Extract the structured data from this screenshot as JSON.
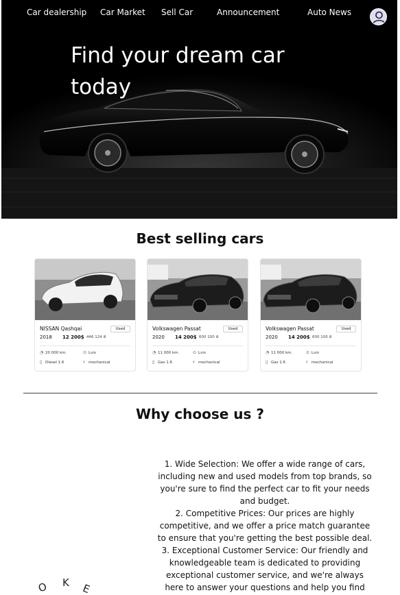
{
  "nav": {
    "items": [
      "Car dealership",
      "Car Market",
      "Sell Car",
      "Announcement",
      "Auto News"
    ]
  },
  "hero": {
    "title": "Find your dream car today"
  },
  "best": {
    "title": "Best selling cars",
    "cards": [
      {
        "name": "NISSAN Qashqai",
        "badge": "Used",
        "year": "2018",
        "price": "12 200$",
        "uah": "446 124 ₴",
        "km": "20 000 km.",
        "city": "Lviv",
        "fuel": "Diesel 1.6",
        "gearbox": "mechanical",
        "color": "#f2f2f2"
      },
      {
        "name": "Volkswagen Passat",
        "badge": "Used",
        "year": "2020",
        "price": "14 200$",
        "uah": "600 100 ₴",
        "km": "11 000 km.",
        "city": "Lviv",
        "fuel": "Gas 1.6",
        "gearbox": "mechanical",
        "color": "#1c1c1c"
      },
      {
        "name": "Volkswagen Passat",
        "badge": "Used",
        "year": "2020",
        "price": "14 200$",
        "uah": "600 100 ₴",
        "km": "11 000 km.",
        "city": "Lviv",
        "fuel": "Gas 1.6",
        "gearbox": "mechanical",
        "color": "#1c1c1c"
      }
    ]
  },
  "why": {
    "title": "Why choose us ?",
    "text": "1. Wide Selection: We offer a wide range of cars, including new and used models from top brands, so you're sure to find the perfect car to fit your needs and budget.\n2. Competitive Prices: Our prices are highly competitive, and we offer a price match guarantee to ensure that you're getting the best possible deal.\n3. Exceptional Customer Service: Our friendly and knowledgeable team is dedicated to providing exceptional customer service, and we're always here to answer your questions and help you find"
  },
  "decor": {
    "letters": [
      "O",
      "K",
      "E"
    ]
  },
  "icons": {
    "km": "speedometer-icon",
    "city": "location-pin-icon",
    "fuel": "fuel-pump-icon",
    "gearbox": "gearbox-icon",
    "avatar": "user-avatar-icon"
  }
}
